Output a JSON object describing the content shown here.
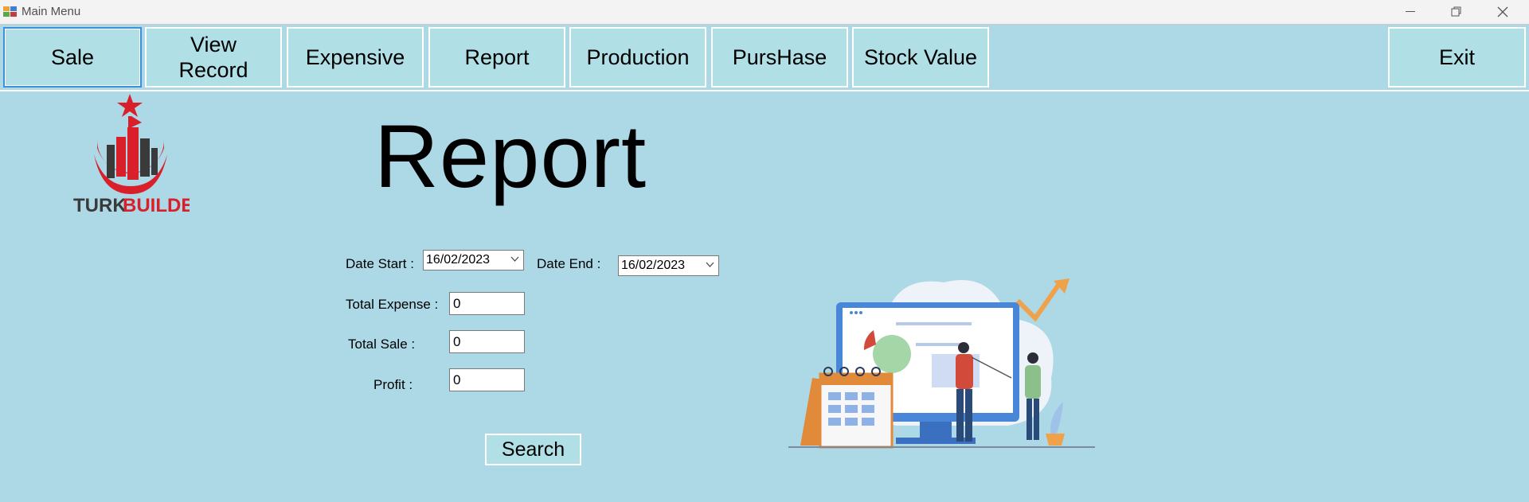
{
  "window": {
    "title": "Main Menu"
  },
  "toolbar": {
    "sale": "Sale",
    "view_record": "View\nRecord",
    "expensive": "Expensive",
    "report": "Report",
    "production": "Production",
    "purchase": "PursHase",
    "stock_value": "Stock Value",
    "exit": "Exit"
  },
  "logo": {
    "brand_left": "TURK",
    "brand_right": "BUILDERS"
  },
  "page": {
    "title": "Report"
  },
  "form": {
    "date_start_label": "Date Start :",
    "date_start_value": "16/02/2023",
    "date_end_label": "Date End :",
    "date_end_value": "16/02/2023",
    "total_expense_label": "Total Expense :",
    "total_expense_value": "0",
    "total_sale_label": "Total Sale :",
    "total_sale_value": "0",
    "profit_label": "Profit :",
    "profit_value": "0",
    "search_label": "Search"
  },
  "colors": {
    "background": "#add8e6",
    "button": "#b0e0e6",
    "logo_red": "#d9202a",
    "logo_dark": "#3a3a3a"
  }
}
